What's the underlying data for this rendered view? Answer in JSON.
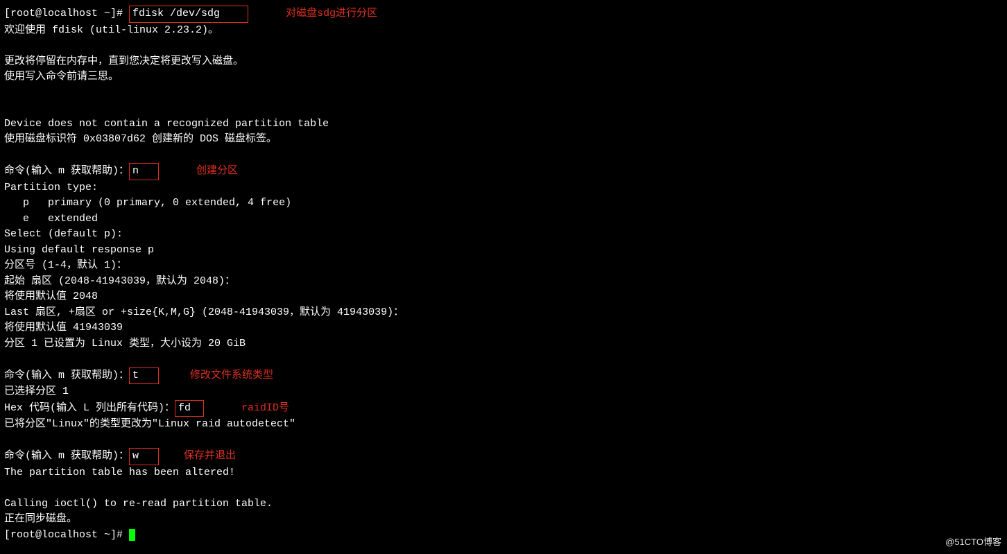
{
  "line1": {
    "prompt": "[root@localhost ~]# ",
    "cmd": "fdisk /dev/sdg",
    "annotation": "对磁盘sdg进行分区"
  },
  "line2": "欢迎使用 fdisk (util-linux 2.23.2)。",
  "line3": "",
  "line4": "更改将停留在内存中，直到您决定将更改写入磁盘。",
  "line5": "使用写入命令前请三思。",
  "line6": "",
  "line7": "",
  "line8": "Device does not contain a recognized partition table",
  "line9": "使用磁盘标识符 0x03807d62 创建新的 DOS 磁盘标签。",
  "line10": "",
  "cmd_n": {
    "prefix": "命令(输入 m 获取帮助)：",
    "input": "n",
    "annotation": "创建分区"
  },
  "line12": "Partition type:",
  "line13": "   p   primary (0 primary, 0 extended, 4 free)",
  "line14": "   e   extended",
  "line15": "Select (default p):",
  "line16": "Using default response p",
  "line17": "分区号 (1-4，默认 1)：",
  "line18": "起始 扇区 (2048-41943039，默认为 2048)：",
  "line19": "将使用默认值 2048",
  "line20": "Last 扇区, +扇区 or +size{K,M,G} (2048-41943039，默认为 41943039)：",
  "line21": "将使用默认值 41943039",
  "line22": "分区 1 已设置为 Linux 类型，大小设为 20 GiB",
  "line23": "",
  "cmd_t": {
    "prefix": "命令(输入 m 获取帮助)：",
    "input": "t",
    "annotation": "修改文件系统类型"
  },
  "line25": "已选择分区 1",
  "cmd_fd": {
    "prefix": "Hex 代码(输入 L 列出所有代码)：",
    "input": "fd",
    "annotation": "raidID号"
  },
  "line27": "已将分区\"Linux\"的类型更改为\"Linux raid autodetect\"",
  "line28": "",
  "cmd_w": {
    "prefix": "命令(输入 m 获取帮助)：",
    "input": "w",
    "annotation": "保存并退出"
  },
  "line30": "The partition table has been altered!",
  "line31": "",
  "line32": "Calling ioctl() to re-read partition table.",
  "line33": "正在同步磁盘。",
  "line34": "[root@localhost ~]# ",
  "watermark": "@51CTO博客"
}
